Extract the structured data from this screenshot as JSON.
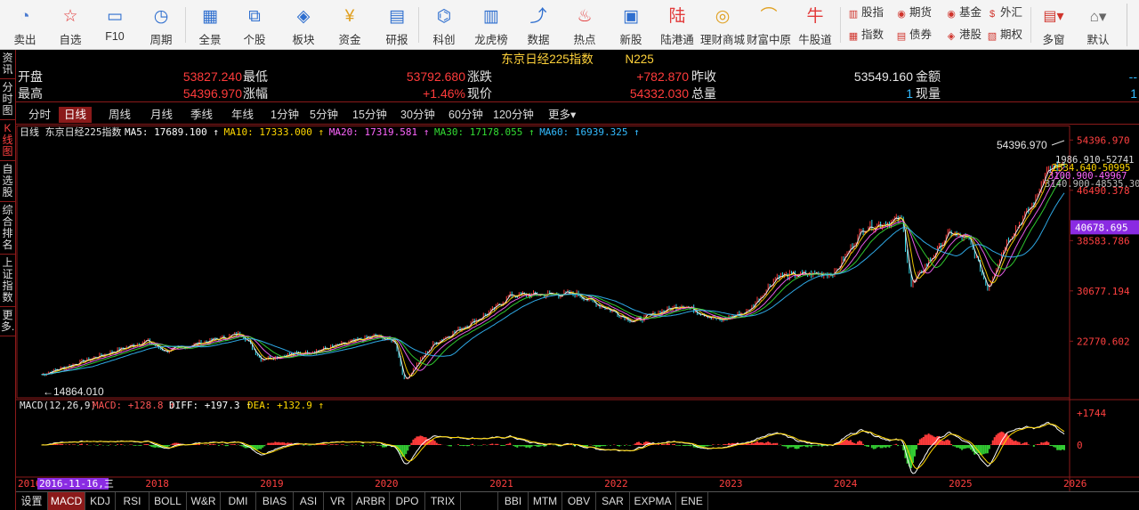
{
  "toolbar": {
    "buttons": [
      {
        "label": "卖出",
        "icon": "sell-icon"
      },
      {
        "label": "自选",
        "icon": "star-icon"
      },
      {
        "label": "F10",
        "icon": "f10-icon"
      },
      {
        "label": "周期",
        "icon": "clock-icon"
      },
      {
        "label": "全景",
        "icon": "grid-icon"
      },
      {
        "label": "个股",
        "icon": "candle-icon"
      },
      {
        "label": "板块",
        "icon": "layers-icon"
      },
      {
        "label": "资金",
        "icon": "coin-icon"
      },
      {
        "label": "研报",
        "icon": "report-icon"
      },
      {
        "label": "科创",
        "icon": "chip-icon"
      },
      {
        "label": "龙虎榜",
        "icon": "bars-icon"
      },
      {
        "label": "数据",
        "icon": "chart-icon"
      },
      {
        "label": "热点",
        "icon": "fire-icon"
      },
      {
        "label": "新股",
        "icon": "ipo-icon"
      },
      {
        "label": "陆港通",
        "icon": "connect-icon"
      },
      {
        "label": "理财商城",
        "icon": "mall-icon"
      },
      {
        "label": "财富中原",
        "icon": "wealth-icon"
      },
      {
        "label": "牛股道",
        "icon": "bull-icon"
      }
    ],
    "icon_glyphs": [
      "◔",
      "☆",
      "▭",
      "◷",
      "▦",
      "⧉",
      "◈",
      "¥",
      "▤",
      "⌬",
      "▥",
      "⤴",
      "♨",
      "▣",
      "陆",
      "◎",
      "⌒",
      "牛"
    ],
    "markets": [
      {
        "label": "股指",
        "icon": "index-icon",
        "glyph": "▥"
      },
      {
        "label": "期货",
        "icon": "futures-icon",
        "glyph": "◉"
      },
      {
        "label": "基金",
        "icon": "fund-icon",
        "glyph": "◉"
      },
      {
        "label": "外汇",
        "icon": "forex-icon",
        "glyph": "$"
      },
      {
        "label": "指数",
        "icon": "index2-icon",
        "glyph": "▦"
      },
      {
        "label": "债券",
        "icon": "bond-icon",
        "glyph": "▤"
      },
      {
        "label": "港股",
        "icon": "hk-icon",
        "glyph": "◈"
      },
      {
        "label": "期权",
        "icon": "option-icon",
        "glyph": "▧"
      }
    ],
    "multi_window": "多窗",
    "default_label": "默认"
  },
  "left_tabs": [
    "资讯",
    "分时图",
    "K线图",
    "自选股",
    "综合排名",
    "上证指数",
    "更多."
  ],
  "left_tabs_active": 2,
  "quote": {
    "name": "东京日经225指数",
    "code": "N225",
    "open_label": "开盘",
    "open": "53827.240",
    "low_label": "最低",
    "low": "53792.680",
    "change_label": "涨跌",
    "change": "+782.870",
    "prev_close_label": "昨收",
    "prev_close": "53549.160",
    "amount_label": "金额",
    "amount": "--",
    "high_label": "最高",
    "high": "54396.970",
    "pct_label": "涨幅",
    "pct": "+1.46%",
    "price_label": "现价",
    "price": "54332.030",
    "volume_label": "总量",
    "volume": "1",
    "cur_vol_label": "现量",
    "cur_vol": "1"
  },
  "period_tabs": [
    "分时",
    "日线",
    "周线",
    "月线",
    "季线",
    "年线",
    "1分钟",
    "5分钟",
    "15分钟",
    "30分钟",
    "60分钟",
    "120分钟",
    "更多▾"
  ],
  "period_active": 1,
  "chart_data": {
    "type": "line",
    "title": "日线 东京日经225指数",
    "ma_legend": [
      {
        "label": "MA5: 17689.100",
        "color": "#ffffff"
      },
      {
        "label": "MA10: 17333.000",
        "color": "#ffd700"
      },
      {
        "label": "MA20: 17319.581",
        "color": "#ff66ff"
      },
      {
        "label": "MA30: 17178.055",
        "color": "#33dd33"
      },
      {
        "label": "MA60: 16939.325",
        "color": "#33bbff"
      }
    ],
    "x": [
      "2017-01",
      "2017-06",
      "2017-12",
      "2018-02",
      "2018-10",
      "2018-12",
      "2019-06",
      "2019-12",
      "2020-02",
      "2020-03",
      "2020-06",
      "2020-12",
      "2021-02",
      "2021-09",
      "2022-03",
      "2022-08",
      "2022-12",
      "2023-03",
      "2023-06",
      "2023-12",
      "2024-03",
      "2024-07",
      "2024-08",
      "2024-12",
      "2025-02",
      "2025-04",
      "2025-06",
      "2025-09",
      "2025-10",
      "2025-12"
    ],
    "y": [
      17500,
      19900,
      22800,
      21200,
      24000,
      20000,
      21300,
      23600,
      22700,
      16550,
      22300,
      27400,
      30000,
      30200,
      25900,
      28500,
      26000,
      27500,
      33000,
      33500,
      40500,
      42000,
      31500,
      39800,
      38700,
      31100,
      38500,
      45000,
      49500,
      50500
    ],
    "ylim": [
      14000,
      55000
    ],
    "y_ticks": [
      54396.97,
      46490.378,
      38583.786,
      30677.194,
      22770.602
    ],
    "y_tick_labels": [
      "54396.970",
      "46490.378",
      "38583.786",
      "30677.194",
      "22770.602"
    ],
    "current_tag": "40678.695",
    "max_label": "54396.970",
    "min_label": "14864.010",
    "right_ma_labels": [
      "1986.910-52741",
      "2534.640-50995",
      "3100.900-49967",
      "3140.900-48535.300"
    ],
    "x_axis_labels": [
      "2016",
      "2018",
      "2019",
      "2020",
      "2021",
      "2022",
      "2023",
      "2024",
      "2025",
      "2026"
    ],
    "cursor_date": "2016-11-16,三"
  },
  "macd": {
    "legend_title": "MACD(12,26,9)",
    "macd_label": "MACD: +128.8",
    "diff_label": "DIFF: +197.3",
    "dea_label": "DEA: +132.9",
    "y_tick_labels": [
      "+1744",
      "0"
    ]
  },
  "indicator_tabs": [
    "设置",
    "MACD",
    "KDJ",
    "RSI",
    "BOLL",
    "W&R",
    "DMI",
    "BIAS",
    "ASI",
    "VR",
    "ARBR",
    "DPO",
    "TRIX",
    "",
    "BBI",
    "MTM",
    "OBV",
    "SAR",
    "EXPMA",
    "ENE"
  ],
  "indicator_active": 1,
  "colors": {
    "up": "#ff3b3b",
    "down": "#33cc33",
    "axis": "#8b1a1a",
    "label": "#ffd23a"
  }
}
